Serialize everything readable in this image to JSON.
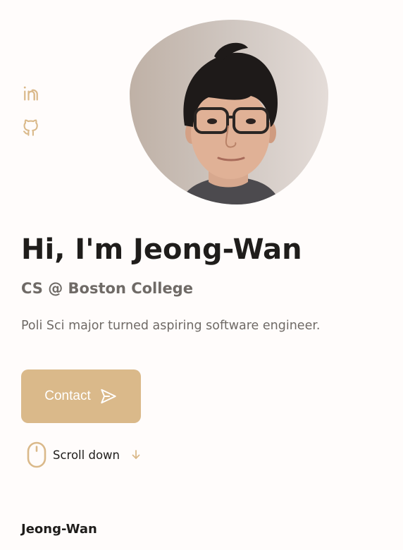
{
  "social": {
    "linkedin_icon": "linkedin-icon",
    "github_icon": "github-icon"
  },
  "hero": {
    "title": "Hi, I'm Jeong-Wan",
    "subtitle": "CS @ Boston College",
    "description": "Poli Sci major turned aspiring software engineer."
  },
  "contact": {
    "label": "Contact",
    "icon": "send-icon"
  },
  "scroll": {
    "label": "Scroll down",
    "mouse_icon": "mouse-icon",
    "arrow_icon": "arrow-down-icon"
  },
  "footer": {
    "name": "Jeong-Wan"
  },
  "colors": {
    "accent": "#dab98a",
    "background": "#fffcfb",
    "title": "#1f1d1b",
    "muted": "#6f6a66"
  }
}
